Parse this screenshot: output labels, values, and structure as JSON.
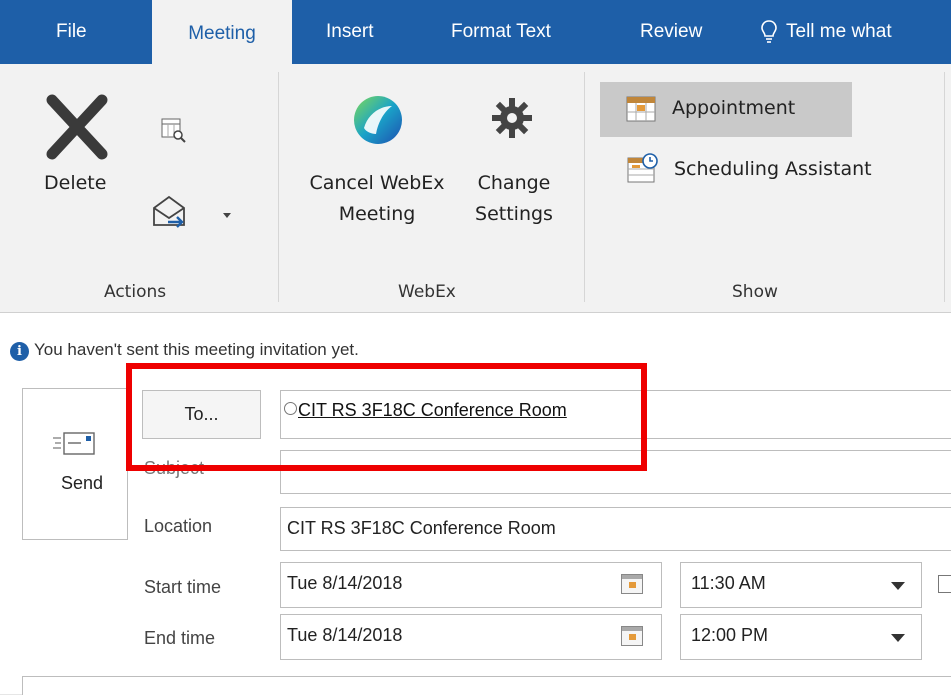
{
  "ribbon": {
    "tabs": [
      "File",
      "Meeting",
      "Insert",
      "Format Text",
      "Review"
    ],
    "tell_me": "Tell me what",
    "delete_label": "Delete",
    "cancel_webex_line1": "Cancel WebEx",
    "cancel_webex_line2": "Meeting",
    "change_settings_line1": "Change",
    "change_settings_line2": "Settings",
    "appointment_label": "Appointment",
    "scheduling_label": "Scheduling Assistant",
    "groups": [
      "Actions",
      "WebEx",
      "Show"
    ]
  },
  "info_bar": "You haven't sent this meeting invitation yet.",
  "compose": {
    "send_label": "Send",
    "to_label": "To...",
    "to_value": "CIT RS 3F18C Conference Room",
    "subject_label": "Subject",
    "subject_value": "",
    "location_label": "Location",
    "location_value": "CIT RS 3F18C Conference Room",
    "start_label": "Start time",
    "start_date": "Tue 8/14/2018",
    "start_time": "11:30 AM",
    "end_label": "End time",
    "end_date": "Tue 8/14/2018",
    "end_time": "12:00 PM"
  },
  "colors": {
    "ribbon_blue": "#1e5fa8",
    "highlight_red": "#ee0000"
  }
}
